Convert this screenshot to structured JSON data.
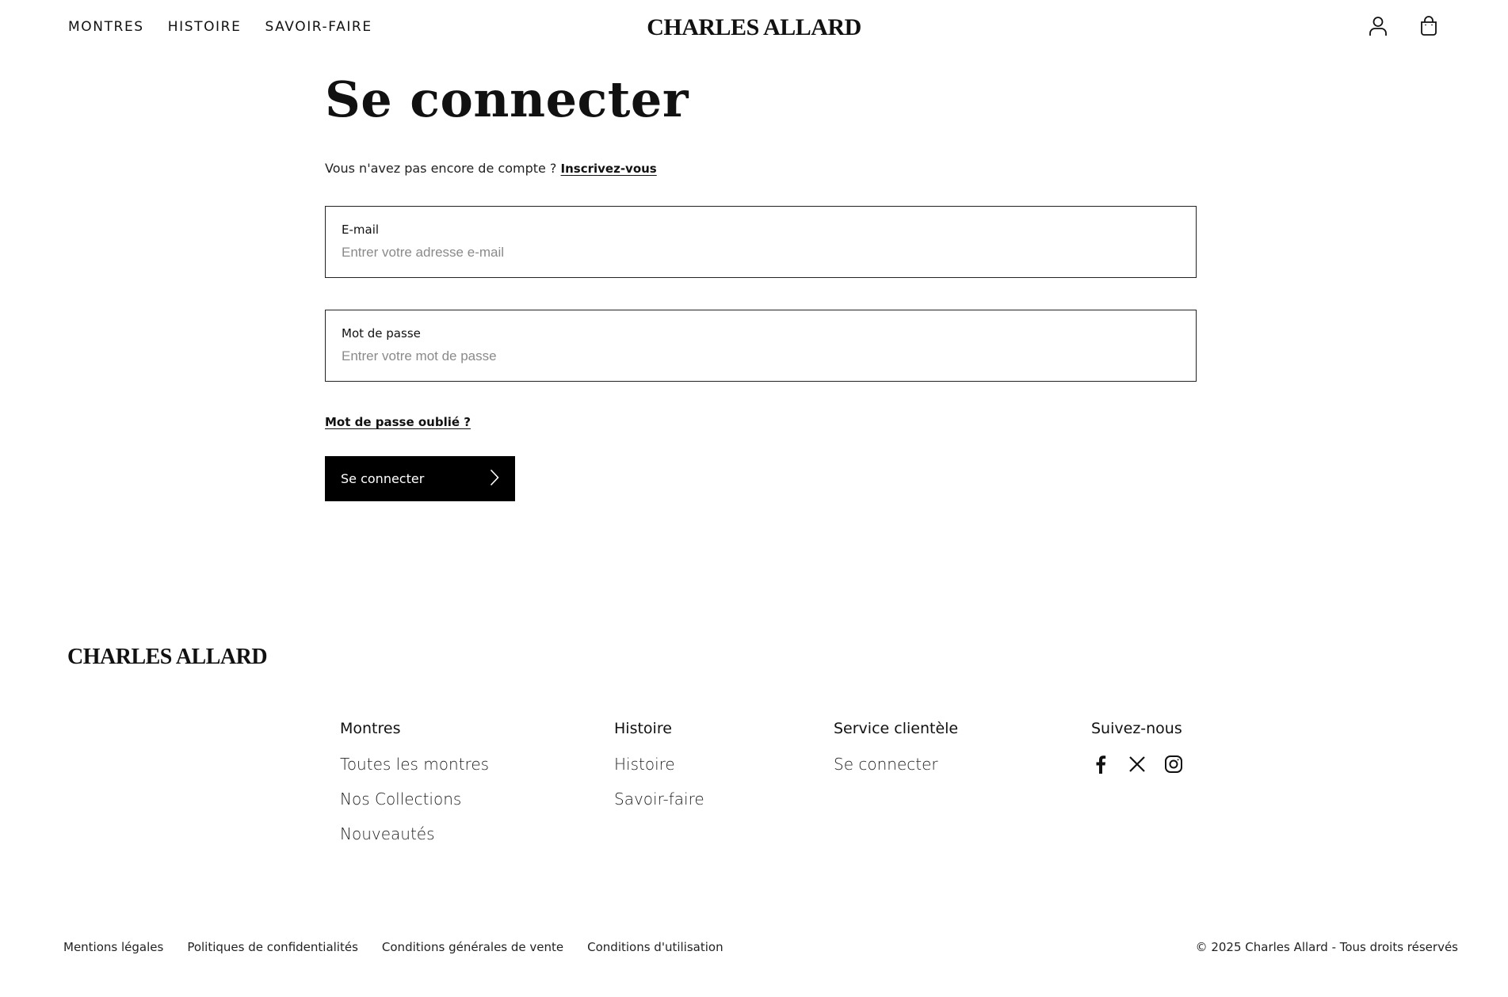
{
  "header": {
    "nav": [
      "MONTRES",
      "HISTOIRE",
      "SAVOIR-FAIRE"
    ],
    "logo": "CHARLES ALLARD",
    "icons": [
      "user-icon",
      "shopping-bag-icon"
    ]
  },
  "main": {
    "title": "Se connecter",
    "signup_prompt": "Vous n'avez pas encore de compte ?",
    "signup_link": "Inscrivez-vous",
    "email": {
      "label": "E-mail",
      "placeholder": "Entrer votre adresse e-mail",
      "value": ""
    },
    "password": {
      "label": "Mot de passe",
      "placeholder": "Entrer votre mot de passe",
      "value": ""
    },
    "forgot": "Mot de passe oublié ?",
    "submit": "Se connecter",
    "submit_icon": "chevron-right-icon"
  },
  "footer": {
    "logo": "CHARLES ALLARD",
    "columns": [
      {
        "title": "Montres",
        "links": [
          "Toutes les montres",
          "Nos Collections",
          "Nouveautés"
        ]
      },
      {
        "title": "Histoire",
        "links": [
          "Histoire",
          "Savoir-faire"
        ]
      },
      {
        "title": "Service clientèle",
        "links": [
          "Se connecter"
        ]
      },
      {
        "title": "Suivez-nous",
        "socials": [
          "facebook-icon",
          "x-icon",
          "instagram-icon"
        ]
      }
    ],
    "legal": [
      "Mentions légales",
      "Politiques de confidentialités",
      "Conditions générales de vente",
      "Conditions d'utilisation"
    ],
    "copyright": "© 2025 Charles Allard - Tous droits réservés"
  }
}
